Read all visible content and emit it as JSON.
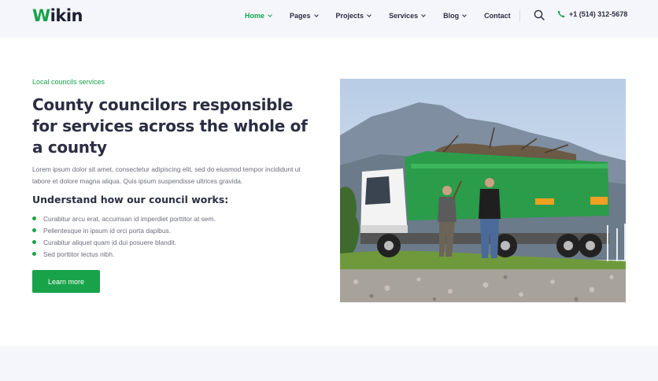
{
  "brand": {
    "logo_first": "W",
    "logo_rest": "ikin",
    "accent": "#18a34a"
  },
  "nav": {
    "items": [
      {
        "label": "Home",
        "has_dropdown": true,
        "active": true
      },
      {
        "label": "Pages",
        "has_dropdown": true
      },
      {
        "label": "Projects",
        "has_dropdown": true
      },
      {
        "label": "Services",
        "has_dropdown": true
      },
      {
        "label": "Blog",
        "has_dropdown": true
      },
      {
        "label": "Contact",
        "has_dropdown": false
      }
    ],
    "phone": "+1 (514) 312-5678",
    "icons": [
      "search-icon",
      "phone-icon",
      "chevron-down-icon"
    ]
  },
  "hero": {
    "eyebrow": "Local councils services",
    "title": "County councilors responsible for services across the whole of a county",
    "description": "Lorem ipsum dolor sit amet, consectetur adipiscing elit, sed do eiusmod tempor incididunt ut labore et dolore magna aliqua. Quis ipsum suspendisse ultrices gravida.",
    "subheading": "Understand how our council works:",
    "bullets": [
      "Curabitur arcu erat, accumsan id imperdiet porttitor at sem.",
      "Pellentesque in ipsum id orci porta dapibus.",
      "Curabitur aliquet quam id dui posuere blandit.",
      "Sed porttitor lectus nibh."
    ],
    "button_label": "Learn more"
  }
}
